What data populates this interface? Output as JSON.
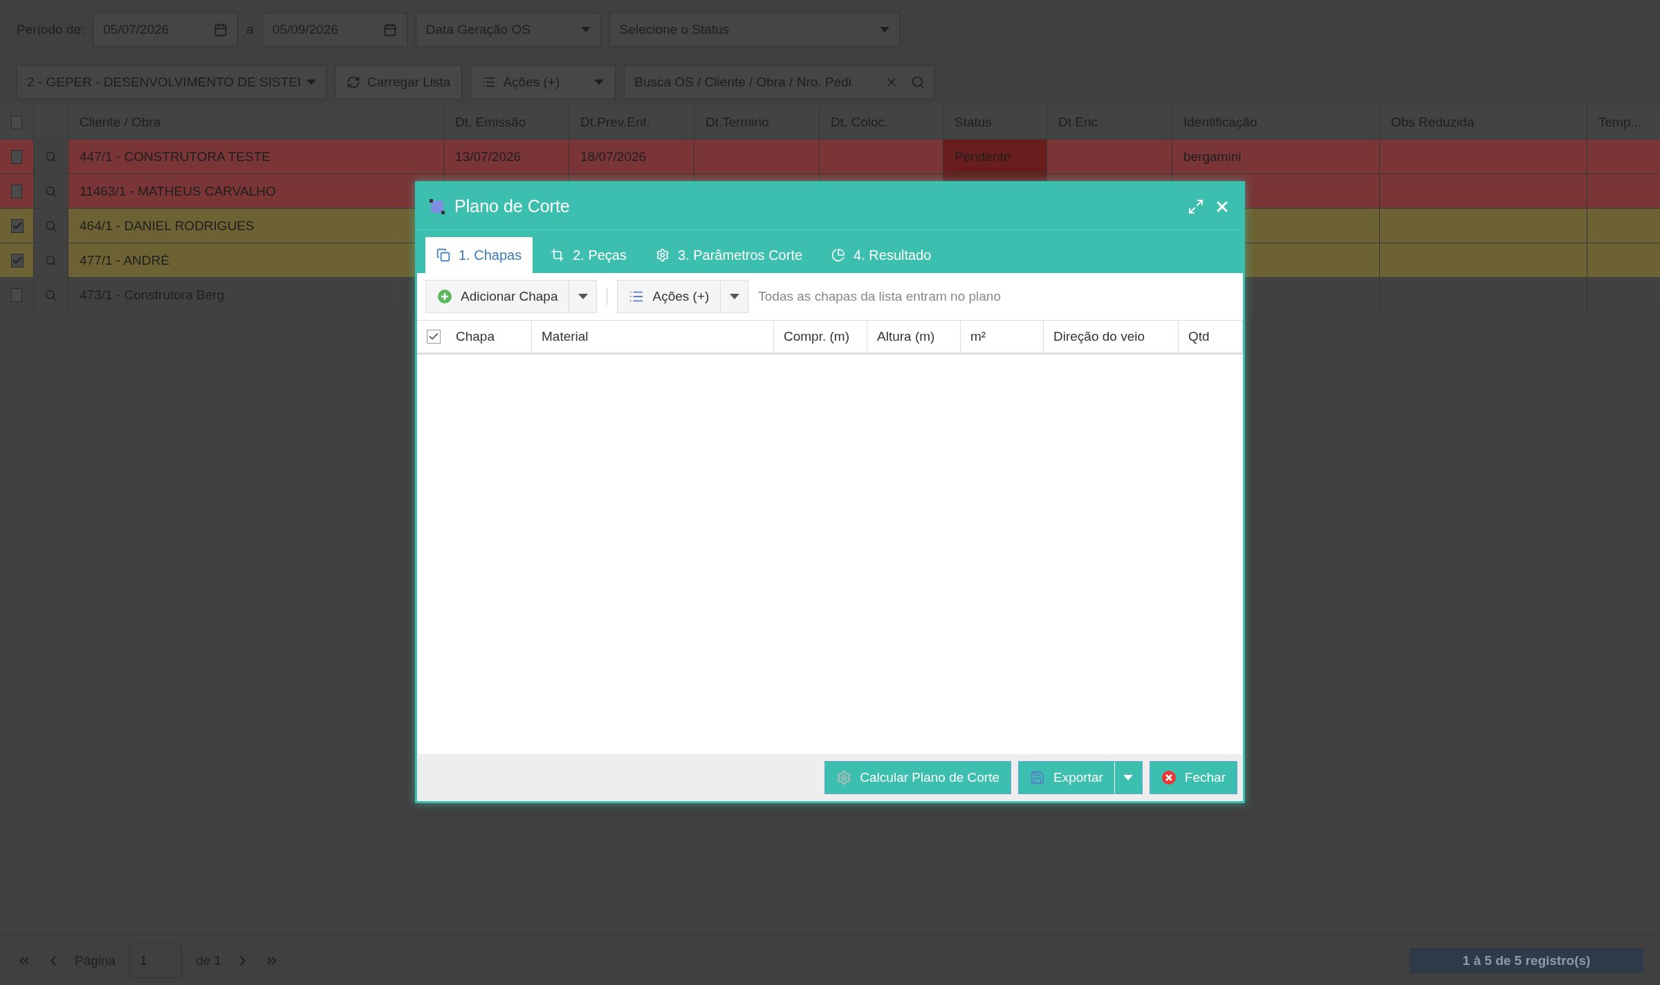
{
  "filters": {
    "period_label": "Período de:",
    "date_from": "05/07/2026",
    "separator": "a",
    "date_to": "05/09/2026",
    "date_type": "Data Geração OS",
    "status_placeholder": "Selecione o Status",
    "company": "2 - GEPER - DESENVOLVIMENTO DE SISTEI",
    "load_button": "Carregar Lista",
    "actions_button": "Ações (+)",
    "search_placeholder": "Busca OS / Cliente / Obra / Nro. Pedi"
  },
  "table": {
    "all_checked": false,
    "columns": [
      "Cliente / Obra",
      "Dt. Emissão",
      "Dt.Prev.Ent.",
      "Dt.Termino",
      "Dt. Coloc.",
      "Status",
      "Dt Enc",
      "Identificação",
      "Obs Reduzida",
      "Temp..."
    ],
    "rows": [
      {
        "checked": false,
        "color": "#7a3636",
        "status_alert": true,
        "cells": [
          "447/1 - CONSTRUTORA TESTE",
          "13/07/2026",
          "18/07/2026",
          "",
          "",
          "Pendente",
          "",
          "bergamini",
          "",
          ""
        ]
      },
      {
        "checked": false,
        "color": "#7a3636",
        "status_alert": true,
        "cells": [
          "11463/1 - MATHEUS CARVALHO",
          "",
          "",
          "",
          "",
          "",
          "",
          "",
          "",
          ""
        ]
      },
      {
        "checked": true,
        "color": "#6d6233",
        "cells": [
          "464/1 - DANIEL RODRIGUES",
          "",
          "",
          "",
          "",
          "",
          "",
          "",
          "",
          ""
        ]
      },
      {
        "checked": true,
        "color": "#6d6233",
        "cells": [
          "477/1 - ANDRÉ",
          "",
          "",
          "",
          "",
          "",
          "",
          "",
          "",
          ""
        ]
      },
      {
        "checked": false,
        "color": "#414141",
        "cells": [
          "473/1 - Construtora Berg",
          "",
          "",
          "",
          "",
          "",
          "",
          "",
          "",
          ""
        ]
      }
    ]
  },
  "pager": {
    "page_label": "Página",
    "page": "1",
    "of_label": "de 1",
    "summary": "1 à 5 de 5 registro(s)"
  },
  "modal": {
    "title": "Plano de Corte",
    "tabs": [
      {
        "label": "1. Chapas",
        "selected": true
      },
      {
        "label": "2. Peças",
        "selected": false
      },
      {
        "label": "3. Parâmetros Corte",
        "selected": false
      },
      {
        "label": "4. Resultado",
        "selected": false
      }
    ],
    "add_button": "Adicionar Chapa",
    "actions_button": "Ações (+)",
    "note": "Todas as chapas da lista entram no plano",
    "all_checked": true,
    "columns": [
      "Chapa",
      "Material",
      "Compr. (m)",
      "Altura (m)",
      "m²",
      "Direção do veio",
      "Qtd"
    ],
    "footer": {
      "calculate": "Calcular Plano de Corte",
      "export": "Exportar",
      "close": "Fechar"
    }
  }
}
